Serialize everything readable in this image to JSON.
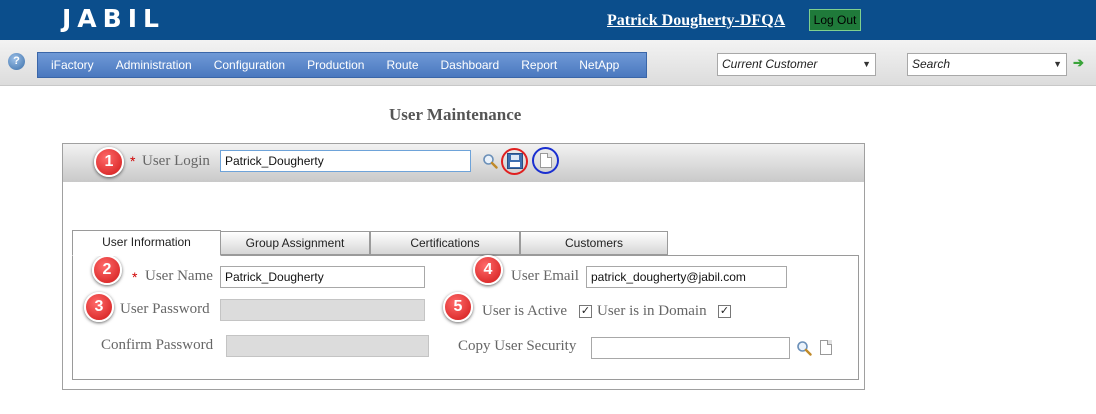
{
  "header": {
    "logo": "JABIL",
    "user": "Patrick Dougherty-DFQA",
    "logout": "Log Out"
  },
  "nav": {
    "help": "?",
    "menu": [
      "iFactory",
      "Administration",
      "Configuration",
      "Production",
      "Route",
      "Dashboard",
      "Report",
      "NetApp"
    ],
    "customer_select": "Current Customer",
    "search_select": "Search"
  },
  "page": {
    "title": "User Maintenance"
  },
  "form": {
    "required_mark": "*",
    "login_label": "User Login",
    "login_value": "Patrick_Dougherty",
    "tabs": [
      "User Information",
      "Group Assignment",
      "Certifications",
      "Customers"
    ],
    "user_name_label": "User Name",
    "user_name_value": "Patrick_Dougherty",
    "password_label": "User Password",
    "confirm_password_label": "Confirm Password",
    "email_label": "User Email",
    "email_value": "patrick_dougherty@jabil.com",
    "active_label": "User is Active",
    "active_checked": true,
    "domain_label": "User is in Domain",
    "domain_checked": true,
    "copy_security_label": "Copy User Security",
    "copy_security_value": ""
  },
  "callouts": [
    "1",
    "2",
    "3",
    "4",
    "5"
  ],
  "colors": {
    "header_bg": "#0b4e8c",
    "menu_bg": "#5a86c8",
    "callout_red": "#d01818",
    "save_ring": "#e02020",
    "new_ring": "#1a2fd0"
  }
}
